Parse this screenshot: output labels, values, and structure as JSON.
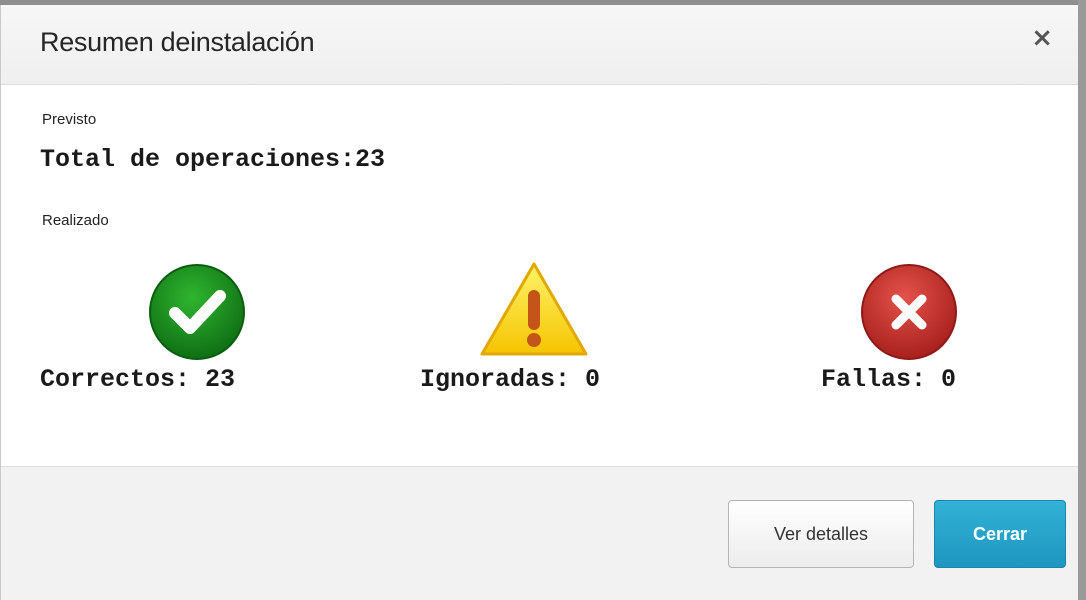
{
  "dialog": {
    "title": "Resumen deinstalación",
    "close_symbol": "×"
  },
  "planned": {
    "label": "Previsto",
    "total_text": "Total de operaciones:23"
  },
  "done": {
    "label": "Realizado",
    "stats": [
      {
        "icon": "success-check-icon",
        "text": "Correctos: 23",
        "color": "#1e8a1e"
      },
      {
        "icon": "warning-icon",
        "text": "Ignoradas: 0",
        "color": "#f5c400"
      },
      {
        "icon": "error-x-icon",
        "text": "Fallas: 0",
        "color": "#c9302c"
      }
    ]
  },
  "footer": {
    "details_label": "Ver detalles",
    "close_label": "Cerrar"
  },
  "colors": {
    "primary_button": "#23a3cc"
  }
}
